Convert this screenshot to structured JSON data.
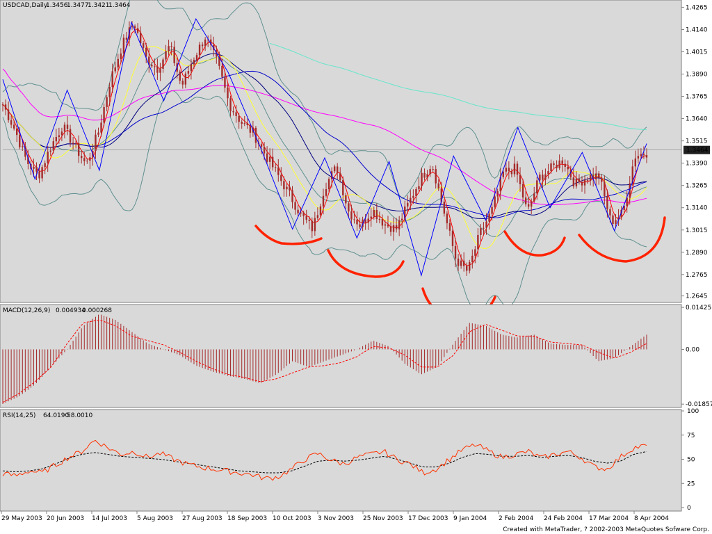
{
  "window": {
    "credit": "Created with MetaTrader, ? 2002-2003 MetaQuotes Sofware Corp."
  },
  "colors": {
    "background": "#d9d9d9",
    "frame": "#7f7f7f",
    "price_tag_bg": "#1f1f1f",
    "price_tag_text": "#ffffff",
    "candle": "#a52a2a",
    "zigzag": "#0000ff",
    "bollinger": "#5f8f8f",
    "ma_red": "#ff0000",
    "ma_yellow": "#ffff33",
    "ma_blue": "#0000cc",
    "ma_navy": "#000080",
    "ma_magenta": "#ff00ff",
    "ma_aqua": "#66e6cc",
    "hand_arcs": "#ff2200",
    "macd_hist": "#a52a2a",
    "macd_signal": "#ff0000",
    "rsi_fast": "#ff3300",
    "rsi_slow": "#000000"
  },
  "chart_data": [
    {
      "type": "candlestick",
      "title": "USDCAD,Daily",
      "header_values": [
        "1.3456",
        "1.3477",
        "1.3421",
        "1.3464"
      ],
      "last_price_label": "1.3464",
      "last_price": 1.3464,
      "ylim": [
        1.262,
        1.429
      ],
      "y_ticks": [
        "1.4265",
        "1.4140",
        "1.4015",
        "1.3890",
        "1.3765",
        "1.3640",
        "1.3515",
        "1.3390",
        "1.3265",
        "1.3140",
        "1.3015",
        "1.2890",
        "1.2765",
        "1.2645"
      ],
      "x_ticks": [
        "29 May 2003",
        "20 Jun 2003",
        "14 Jul 2003",
        "5 Aug 2003",
        "27 Aug 2003",
        "18 Sep 2003",
        "10 Oct 2003",
        "3 Nov 2003",
        "25 Nov 2003",
        "17 Dec 2003",
        "9 Jan 2004",
        "2 Feb 2004",
        "24 Feb 2004",
        "17 Mar 2004",
        "8 Apr 2004"
      ],
      "close_path": [
        1.372,
        1.358,
        1.34,
        1.332,
        1.348,
        1.36,
        1.349,
        1.338,
        1.356,
        1.385,
        1.405,
        1.418,
        1.398,
        1.392,
        1.405,
        1.382,
        1.398,
        1.41,
        1.395,
        1.372,
        1.362,
        1.356,
        1.344,
        1.333,
        1.322,
        1.31,
        1.302,
        1.326,
        1.337,
        1.312,
        1.304,
        1.313,
        1.305,
        1.302,
        1.316,
        1.33,
        1.339,
        1.312,
        1.285,
        1.278,
        1.299,
        1.312,
        1.334,
        1.336,
        1.311,
        1.331,
        1.336,
        1.341,
        1.327,
        1.331,
        1.332,
        1.306,
        1.311,
        1.343,
        1.345
      ],
      "zigzag_path": [
        1.386,
        1.33,
        1.38,
        1.335,
        1.418,
        1.374,
        1.42,
        1.39,
        1.348,
        1.302,
        1.342,
        1.297,
        1.34,
        1.276,
        1.343,
        1.307,
        1.359,
        1.314,
        1.345,
        1.301,
        1.35
      ],
      "annotations": "hand-drawn red rounded-bottom arcs under seven troughs"
    },
    {
      "type": "bar+line",
      "title": "MACD(12,26,9)",
      "header_values": [
        "0.004934",
        "0.000268"
      ],
      "ylim": [
        -0.019,
        0.0145
      ],
      "y_ticks": [
        "0.01425",
        "0.00",
        "-0.01857"
      ],
      "hist_path": [
        -0.0185,
        -0.016,
        -0.012,
        -0.006,
        0.0,
        0.008,
        0.012,
        0.01,
        0.006,
        0.002,
        0.0,
        -0.002,
        -0.0055,
        -0.0075,
        -0.009,
        -0.01,
        -0.0115,
        -0.0085,
        -0.004,
        -0.006,
        -0.004,
        -0.002,
        0.0,
        0.003,
        0.001,
        -0.005,
        -0.0085,
        -0.006,
        0.002,
        0.009,
        0.008,
        0.005,
        0.004,
        0.005,
        0.002,
        0.0015,
        0.0015,
        -0.004,
        -0.003,
        0.001,
        0.005
      ],
      "signal_path": [
        -0.018,
        -0.015,
        -0.011,
        -0.006,
        0.002,
        0.009,
        0.01,
        0.008,
        0.0045,
        0.003,
        0.0015,
        -0.001,
        -0.004,
        -0.0065,
        -0.0085,
        -0.0095,
        -0.011,
        -0.01,
        -0.008,
        -0.006,
        -0.0055,
        -0.0045,
        -0.0025,
        0.001,
        0.0005,
        -0.002,
        -0.006,
        -0.006,
        -0.002,
        0.006,
        0.0085,
        0.0065,
        0.0045,
        0.0045,
        0.0025,
        0.002,
        0.0015,
        -0.001,
        -0.003,
        -0.001,
        0.002
      ]
    },
    {
      "type": "line",
      "title": "RSI(14,25)",
      "header_values": [
        "64.0190",
        "58.0010"
      ],
      "ylim": [
        0,
        100
      ],
      "y_ticks": [
        "100",
        "75",
        "50",
        "25",
        "0"
      ],
      "rsi_path": [
        35,
        33,
        38,
        36,
        44,
        52,
        58,
        70,
        62,
        55,
        58,
        52,
        56,
        50,
        45,
        42,
        40,
        38,
        36,
        34,
        30,
        32,
        40,
        50,
        56,
        49,
        45,
        52,
        55,
        58,
        50,
        45,
        36,
        40,
        50,
        60,
        65,
        58,
        52,
        55,
        58,
        51,
        55,
        58,
        52,
        42,
        40,
        52,
        62,
        64
      ],
      "rsi_ma_path": [
        38,
        37,
        38,
        40,
        45,
        51,
        55,
        57,
        55,
        53,
        52,
        51,
        50,
        48,
        46,
        44,
        42,
        40,
        38,
        37,
        36,
        36,
        38,
        43,
        48,
        49,
        48,
        49,
        51,
        53,
        50,
        46,
        42,
        42,
        46,
        52,
        56,
        55,
        53,
        53,
        54,
        52,
        53,
        54,
        52,
        48,
        46,
        48,
        55,
        58
      ]
    }
  ]
}
